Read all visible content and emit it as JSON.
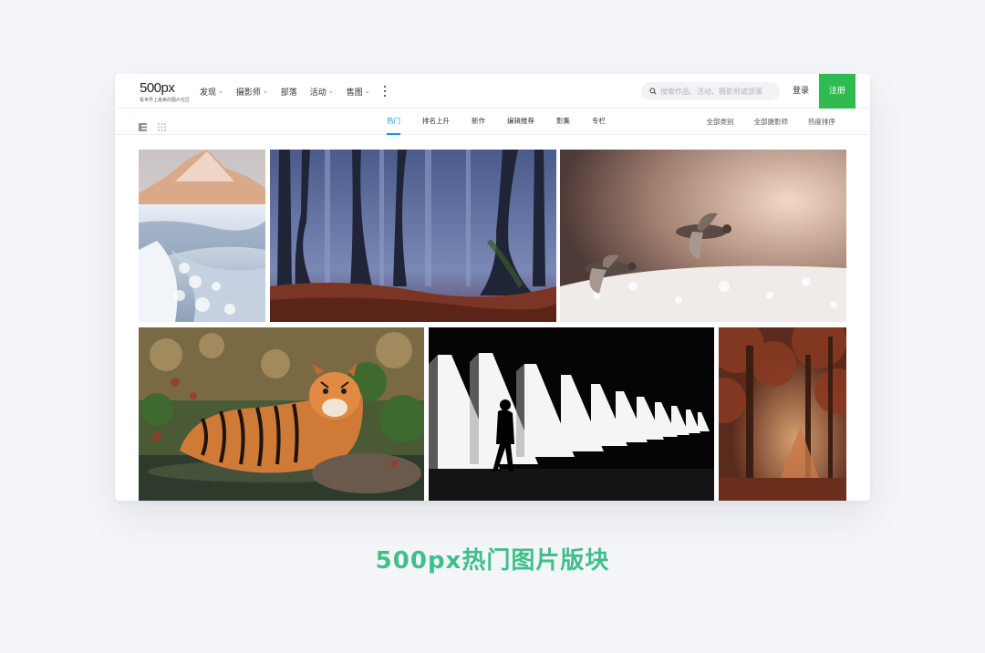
{
  "brand": {
    "logo_text": "500px",
    "logo_tagline": "看世界上最美的图片社区",
    "accent": "#2fbb4f",
    "link_active": "#0e97e5",
    "caption_color": "#3fbf8c"
  },
  "nav": {
    "items": [
      {
        "label": "发现",
        "has_dropdown": true
      },
      {
        "label": "摄影师",
        "has_dropdown": true
      },
      {
        "label": "部落",
        "has_dropdown": false
      },
      {
        "label": "活动",
        "has_dropdown": true
      },
      {
        "label": "售图",
        "has_dropdown": true
      }
    ],
    "more_icon": "vertical-ellipsis-icon",
    "search_placeholder": "搜索作品、活动、摄影师或部落",
    "search_icon": "search-icon",
    "login_label": "登录",
    "register_label": "注册"
  },
  "subnav": {
    "view_icons": [
      "list-view-icon",
      "grid-view-icon"
    ],
    "tabs": [
      {
        "label": "热门",
        "active": true
      },
      {
        "label": "排名上升",
        "active": false
      },
      {
        "label": "新作",
        "active": false
      },
      {
        "label": "编辑推荐",
        "active": false
      },
      {
        "label": "影集",
        "active": false
      },
      {
        "label": "专栏",
        "active": false
      }
    ],
    "filters": [
      "全部类别",
      "全部摄影师",
      "热度排序"
    ]
  },
  "gallery": {
    "photos": [
      {
        "name": "photo-snowy-mountain"
      },
      {
        "name": "photo-misty-forest"
      },
      {
        "name": "photo-flying-ducks"
      },
      {
        "name": "photo-tiger"
      },
      {
        "name": "photo-silhouette-light"
      },
      {
        "name": "photo-autumn-forest"
      }
    ]
  },
  "caption": "500px热门图片版块"
}
